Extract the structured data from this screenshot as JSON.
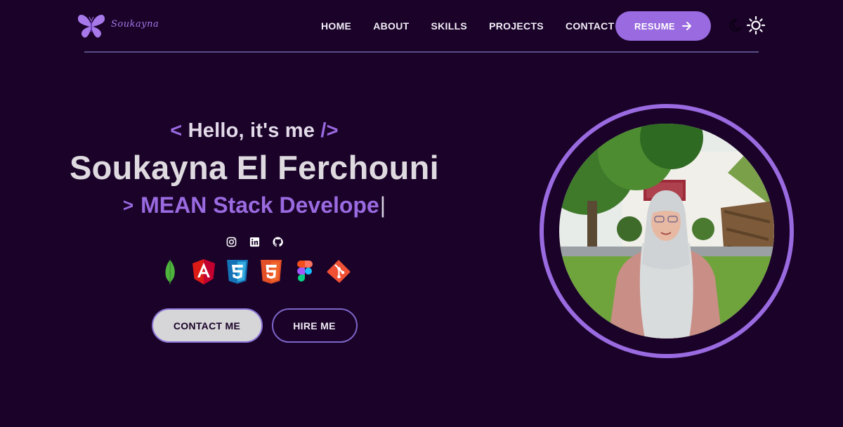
{
  "brand": {
    "name": "Soukayna",
    "logo_icon": "butterfly-icon",
    "color": "#a678ea"
  },
  "nav": {
    "links": [
      {
        "label": "HOME"
      },
      {
        "label": "ABOUT"
      },
      {
        "label": "SKILLS"
      },
      {
        "label": "PROJECTS"
      },
      {
        "label": "CONTACT"
      }
    ],
    "resume_label": "RESUME",
    "resume_icon": "arrow-right-icon",
    "theme_icons": [
      "moon-icon",
      "sun-icon"
    ]
  },
  "hero": {
    "greeting_open": "<",
    "greeting": "Hello, it's me",
    "greeting_close": "/>",
    "name": "Soukayna El Ferchouni",
    "role_prefix": ">",
    "role": "MEAN Stack Develope",
    "cursor": "|",
    "socials": [
      "instagram-icon",
      "linkedin-icon",
      "github-icon"
    ],
    "tech_stack": [
      "mongodb-icon",
      "angular-icon",
      "css3-icon",
      "html5-icon",
      "figma-icon",
      "git-icon"
    ],
    "contact_label": "CONTACT ME",
    "hire_label": "HIRE ME"
  },
  "colors": {
    "background": "#1a0229",
    "accent": "#9a6ae0",
    "divider": "#5a4f86"
  }
}
